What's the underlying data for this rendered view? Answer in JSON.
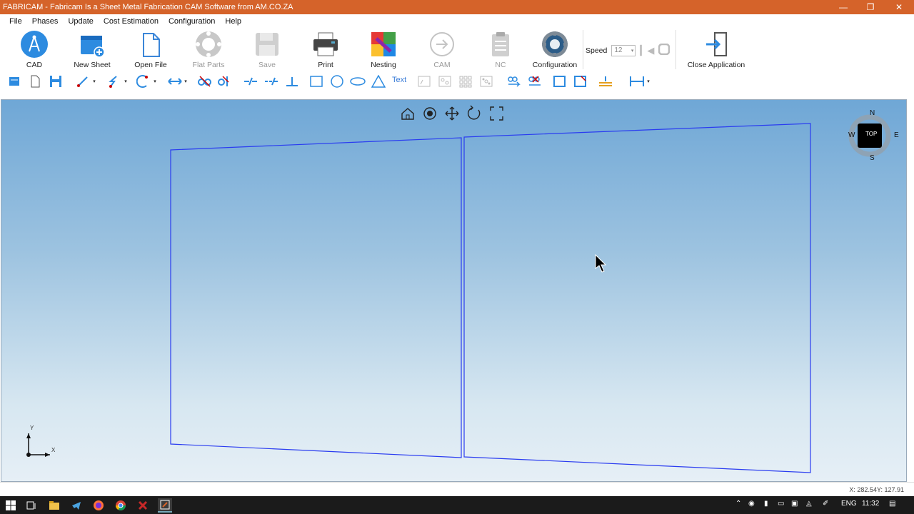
{
  "window": {
    "title": "FABRICAM - Fabricam Is a Sheet Metal Fabrication CAM Software from AM.CO.ZA",
    "accent": "#d5632a"
  },
  "menu": [
    "File",
    "Phases",
    "Update",
    "Cost Estimation",
    "Configuration",
    "Help"
  ],
  "ribbon": {
    "cad": "CAD",
    "new_sheet": "New Sheet",
    "open_file": "Open File",
    "flat_parts": "Flat Parts",
    "save": "Save",
    "print": "Print",
    "nesting": "Nesting",
    "cam": "CAM",
    "nc": "NC",
    "configuration": "Configuration",
    "speed_label": "Speed",
    "speed_value": "12",
    "close_application": "Close Application"
  },
  "toolbar": {
    "text_tool": "Text"
  },
  "viewcube": {
    "n": "N",
    "s": "S",
    "e": "E",
    "w": "W",
    "face": "TOP"
  },
  "axis": {
    "x": "X",
    "y": "Y"
  },
  "status": {
    "coords": "X: 282.54Y: 127.91"
  },
  "taskbar": {
    "lang": "ENG",
    "time": "11:32"
  }
}
